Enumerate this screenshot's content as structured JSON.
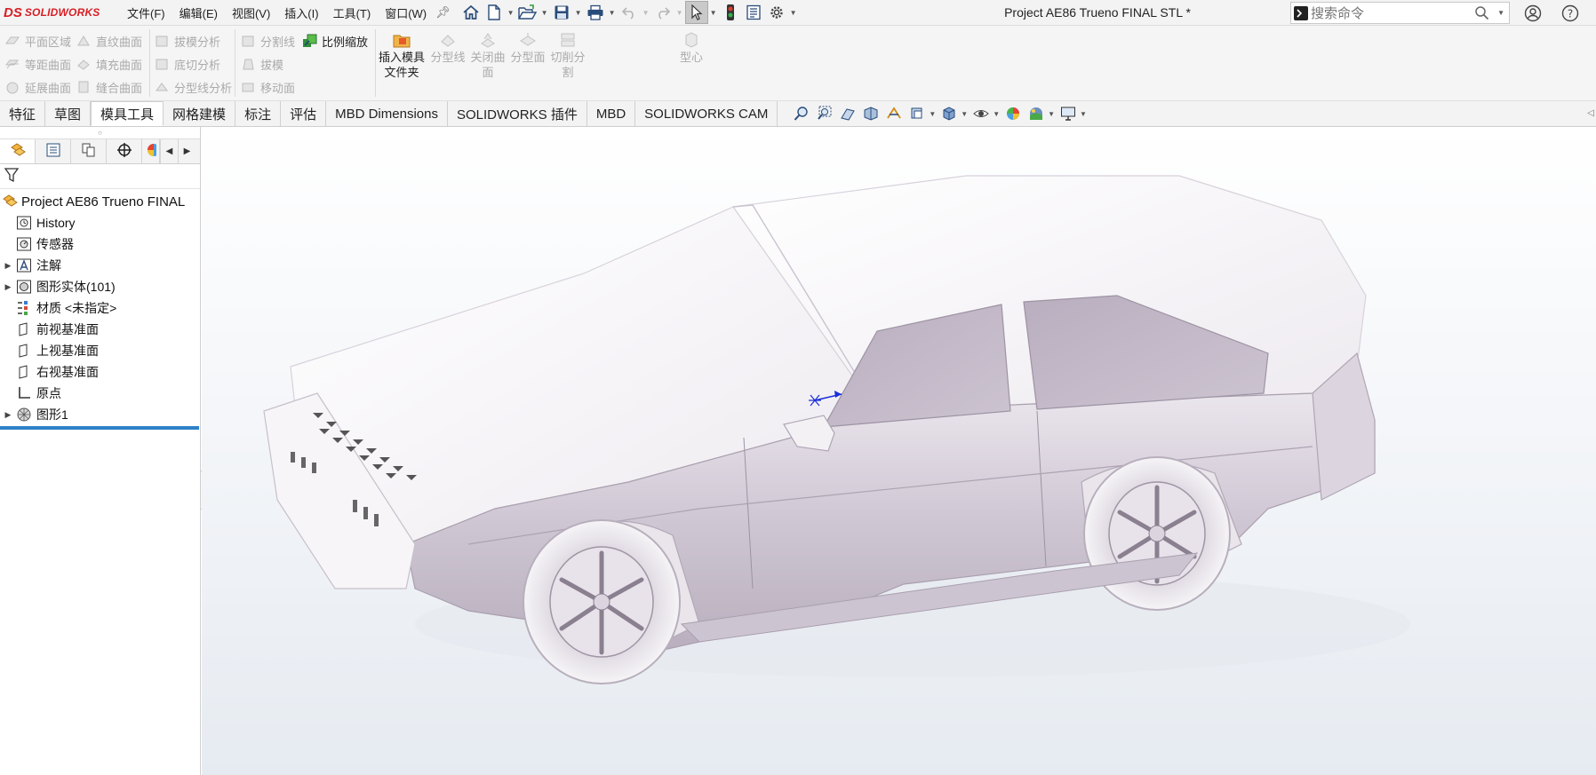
{
  "app": {
    "logo_mark": "DS",
    "logo_text": "SOLIDWORKS",
    "document_title": "Project AE86 Trueno FINAL STL *"
  },
  "menu": [
    "文件(F)",
    "编辑(E)",
    "视图(V)",
    "插入(I)",
    "工具(T)",
    "窗口(W)"
  ],
  "search": {
    "placeholder": "搜索命令"
  },
  "command_manager": {
    "group1": [
      "平面区域",
      "等距曲面",
      "延展曲面"
    ],
    "group2": [
      "直纹曲面",
      "填充曲面",
      "缝合曲面"
    ],
    "group3": [
      "拔模分析",
      "底切分析",
      "分型线分析"
    ],
    "group4": [
      "分割线",
      "拔模",
      "移动面"
    ],
    "scale": "比例缩放",
    "insert_mold_line1": "插入模具",
    "insert_mold_line2": "文件夹",
    "parting_line": "分型线",
    "shutoff_line1": "关闭曲",
    "shutoff_line2": "面",
    "parting_surface": "分型面",
    "split_line1": "切削分",
    "split_line2": "割",
    "core": "型心"
  },
  "tabs": [
    "特征",
    "草图",
    "模具工具",
    "网格建模",
    "标注",
    "评估",
    "MBD Dimensions",
    "SOLIDWORKS 插件",
    "MBD",
    "SOLIDWORKS CAM"
  ],
  "active_tab": "模具工具",
  "feature_tree": {
    "root": "Project AE86 Trueno FINAL",
    "items": [
      {
        "label": "History",
        "icon": "history-icon",
        "expandable": false
      },
      {
        "label": "传感器",
        "icon": "sensor-icon",
        "expandable": false
      },
      {
        "label": "注解",
        "icon": "annotation-icon",
        "expandable": true
      },
      {
        "label": "图形实体(101)",
        "icon": "graphics-body-icon",
        "expandable": true
      },
      {
        "label": "材质 <未指定>",
        "icon": "material-icon",
        "expandable": false
      },
      {
        "label": "前视基准面",
        "icon": "plane-icon",
        "expandable": false
      },
      {
        "label": "上视基准面",
        "icon": "plane-icon",
        "expandable": false
      },
      {
        "label": "右视基准面",
        "icon": "plane-icon",
        "expandable": false
      },
      {
        "label": "原点",
        "icon": "origin-icon",
        "expandable": false
      },
      {
        "label": "图形1",
        "icon": "mesh-icon",
        "expandable": true
      }
    ]
  },
  "colors": {
    "brand": "#d71e24",
    "rollback_bar": "#2f80c8",
    "car_body": "#d3cbd6",
    "triad_axis": "#1a2fd8"
  }
}
